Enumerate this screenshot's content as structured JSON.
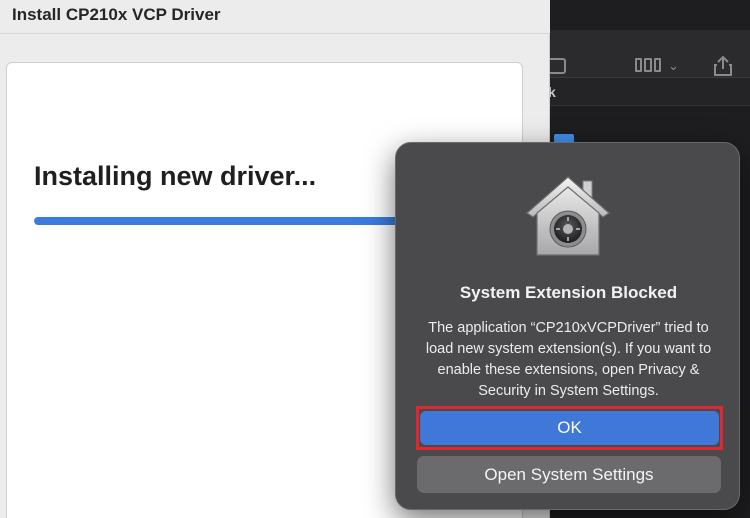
{
  "background_window": {
    "sidebar_label": "k"
  },
  "installer": {
    "title": "Install CP210x VCP Driver",
    "heading": "Installing new driver...",
    "progress": 0.8
  },
  "dialog": {
    "icon": "security-house-lock-icon",
    "title": "System Extension Blocked",
    "message": "The application “CP210xVCPDriver” tried to load new system extension(s). If you want to enable these extensions, open Privacy & Security in System Settings.",
    "ok_label": "OK",
    "settings_label": "Open System Settings",
    "highlight_color": "#e2262f"
  },
  "colors": {
    "accent": "#3f78d8",
    "progress": "#3a7bde"
  }
}
